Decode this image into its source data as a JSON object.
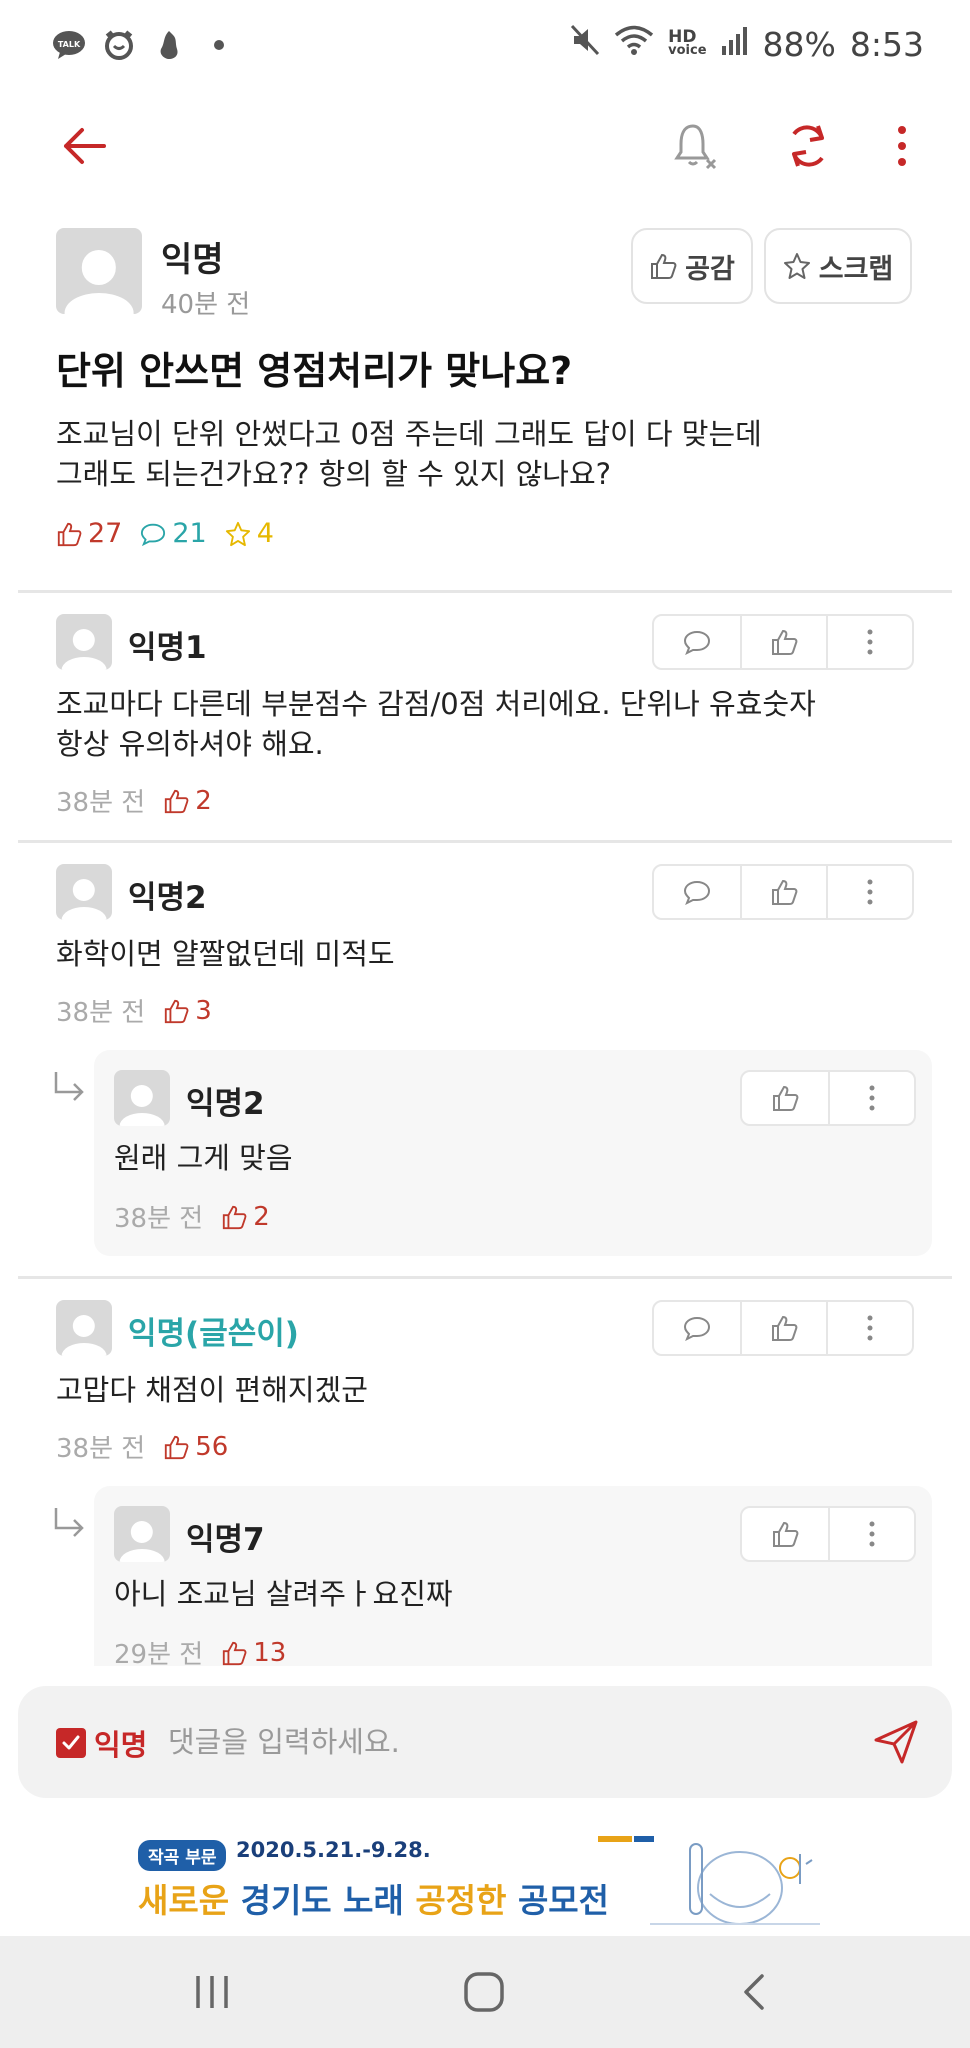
{
  "status_bar": {
    "battery": "88%",
    "time": "8:53",
    "hd_label": "HD",
    "voice_label": "voice",
    "talk_label": "TALK",
    "icons": [
      "kakaotalk-icon",
      "alarm-icon",
      "app-icon",
      "dot-icon",
      "mute-icon",
      "wifi-icon",
      "signal-icon"
    ]
  },
  "post": {
    "author": "익명",
    "time": "40분 전",
    "like_button_label": "공감",
    "scrap_button_label": "스크랩",
    "title": "단위 안쓰면 영점처리가 맞나요?",
    "body_lines": [
      "조교님이 단위 안썼다고 0점 주는데 그래도 답이 다 맞는데",
      "그래도 되는건가요?? 항의 할 수 있지 않나요?"
    ],
    "likes": "27",
    "comments": "21",
    "scraps": "4"
  },
  "comments": [
    {
      "author": "익명1",
      "lines": [
        "조교마다 다른데 부분점수 감점/0점 처리에요. 단위나 유효숫자",
        "항상 유의하셔야 해요."
      ],
      "time": "38분 전",
      "likes": "2"
    },
    {
      "author": "익명2",
      "lines": [
        "화학이면 얄짤없던데 미적도"
      ],
      "time": "38분 전",
      "likes": "3",
      "reply": {
        "author": "익명2",
        "text": "원래 그게 맞음",
        "time": "38분 전",
        "likes": "2"
      }
    },
    {
      "author": "익명(글쓴이)",
      "lines": [
        "고맙다 채점이 편해지겠군"
      ],
      "time": "38분 전",
      "likes": "56",
      "reply": {
        "author": "익명7",
        "text": "아니 조교님 살려주ㅏ요진짜",
        "time": "29분 전",
        "likes": "13"
      }
    }
  ],
  "input_bar": {
    "anonymous_label": "익명",
    "anonymous_checked": true,
    "placeholder": "댓글을 입력하세요."
  },
  "banner": {
    "badge": "작곡 부문",
    "date": "2020.5.21.-9.28.",
    "title_parts": [
      "새로운 ",
      "경기도 노래 ",
      "공정한 ",
      "공모전"
    ]
  },
  "colors": {
    "accent_red": "#c62828",
    "like_red": "#c0392b",
    "comment_teal": "#2aa5a8",
    "scrap_yellow": "#e6b800",
    "op_teal": "#2aa5a8"
  }
}
